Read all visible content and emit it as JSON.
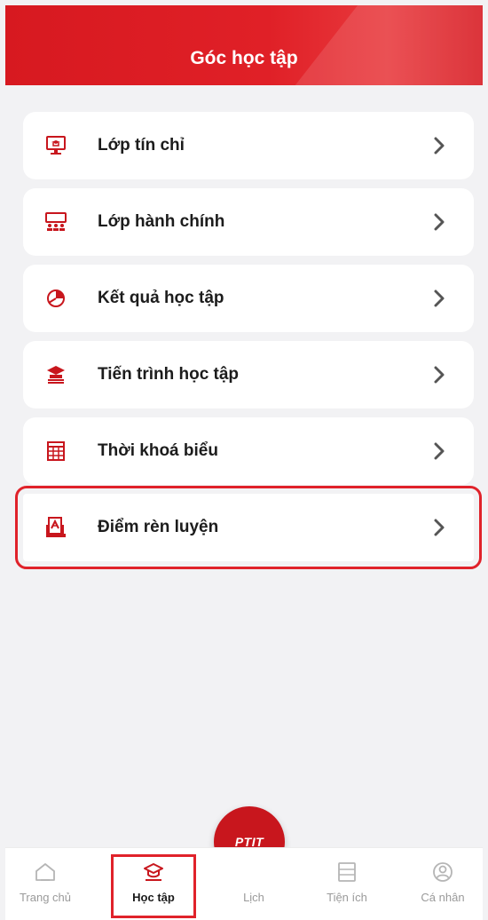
{
  "header": {
    "title": "Góc học tập"
  },
  "menu": {
    "items": [
      {
        "label": "Lớp tín chỉ",
        "icon": "monitor-class-icon"
      },
      {
        "label": "Lớp hành chính",
        "icon": "classroom-icon"
      },
      {
        "label": "Kết quả học tập",
        "icon": "pie-chart-icon"
      },
      {
        "label": "Tiến trình học tập",
        "icon": "graduation-cap-icon"
      },
      {
        "label": "Thời khoá biểu",
        "icon": "timetable-icon"
      },
      {
        "label": "Điểm rèn luyện",
        "icon": "score-report-icon"
      }
    ]
  },
  "fab": {
    "label": "PTIT"
  },
  "bottom_nav": {
    "items": [
      {
        "label": "Trang chủ",
        "icon": "home-icon"
      },
      {
        "label": "Học tập",
        "icon": "graduation-cap-icon"
      },
      {
        "label": "Lịch",
        "icon": ""
      },
      {
        "label": "Tiện ích",
        "icon": "utilities-icon"
      },
      {
        "label": "Cá nhân",
        "icon": "user-profile-icon"
      }
    ]
  },
  "colors": {
    "accent": "#d71920",
    "highlight": "#e0222a"
  }
}
